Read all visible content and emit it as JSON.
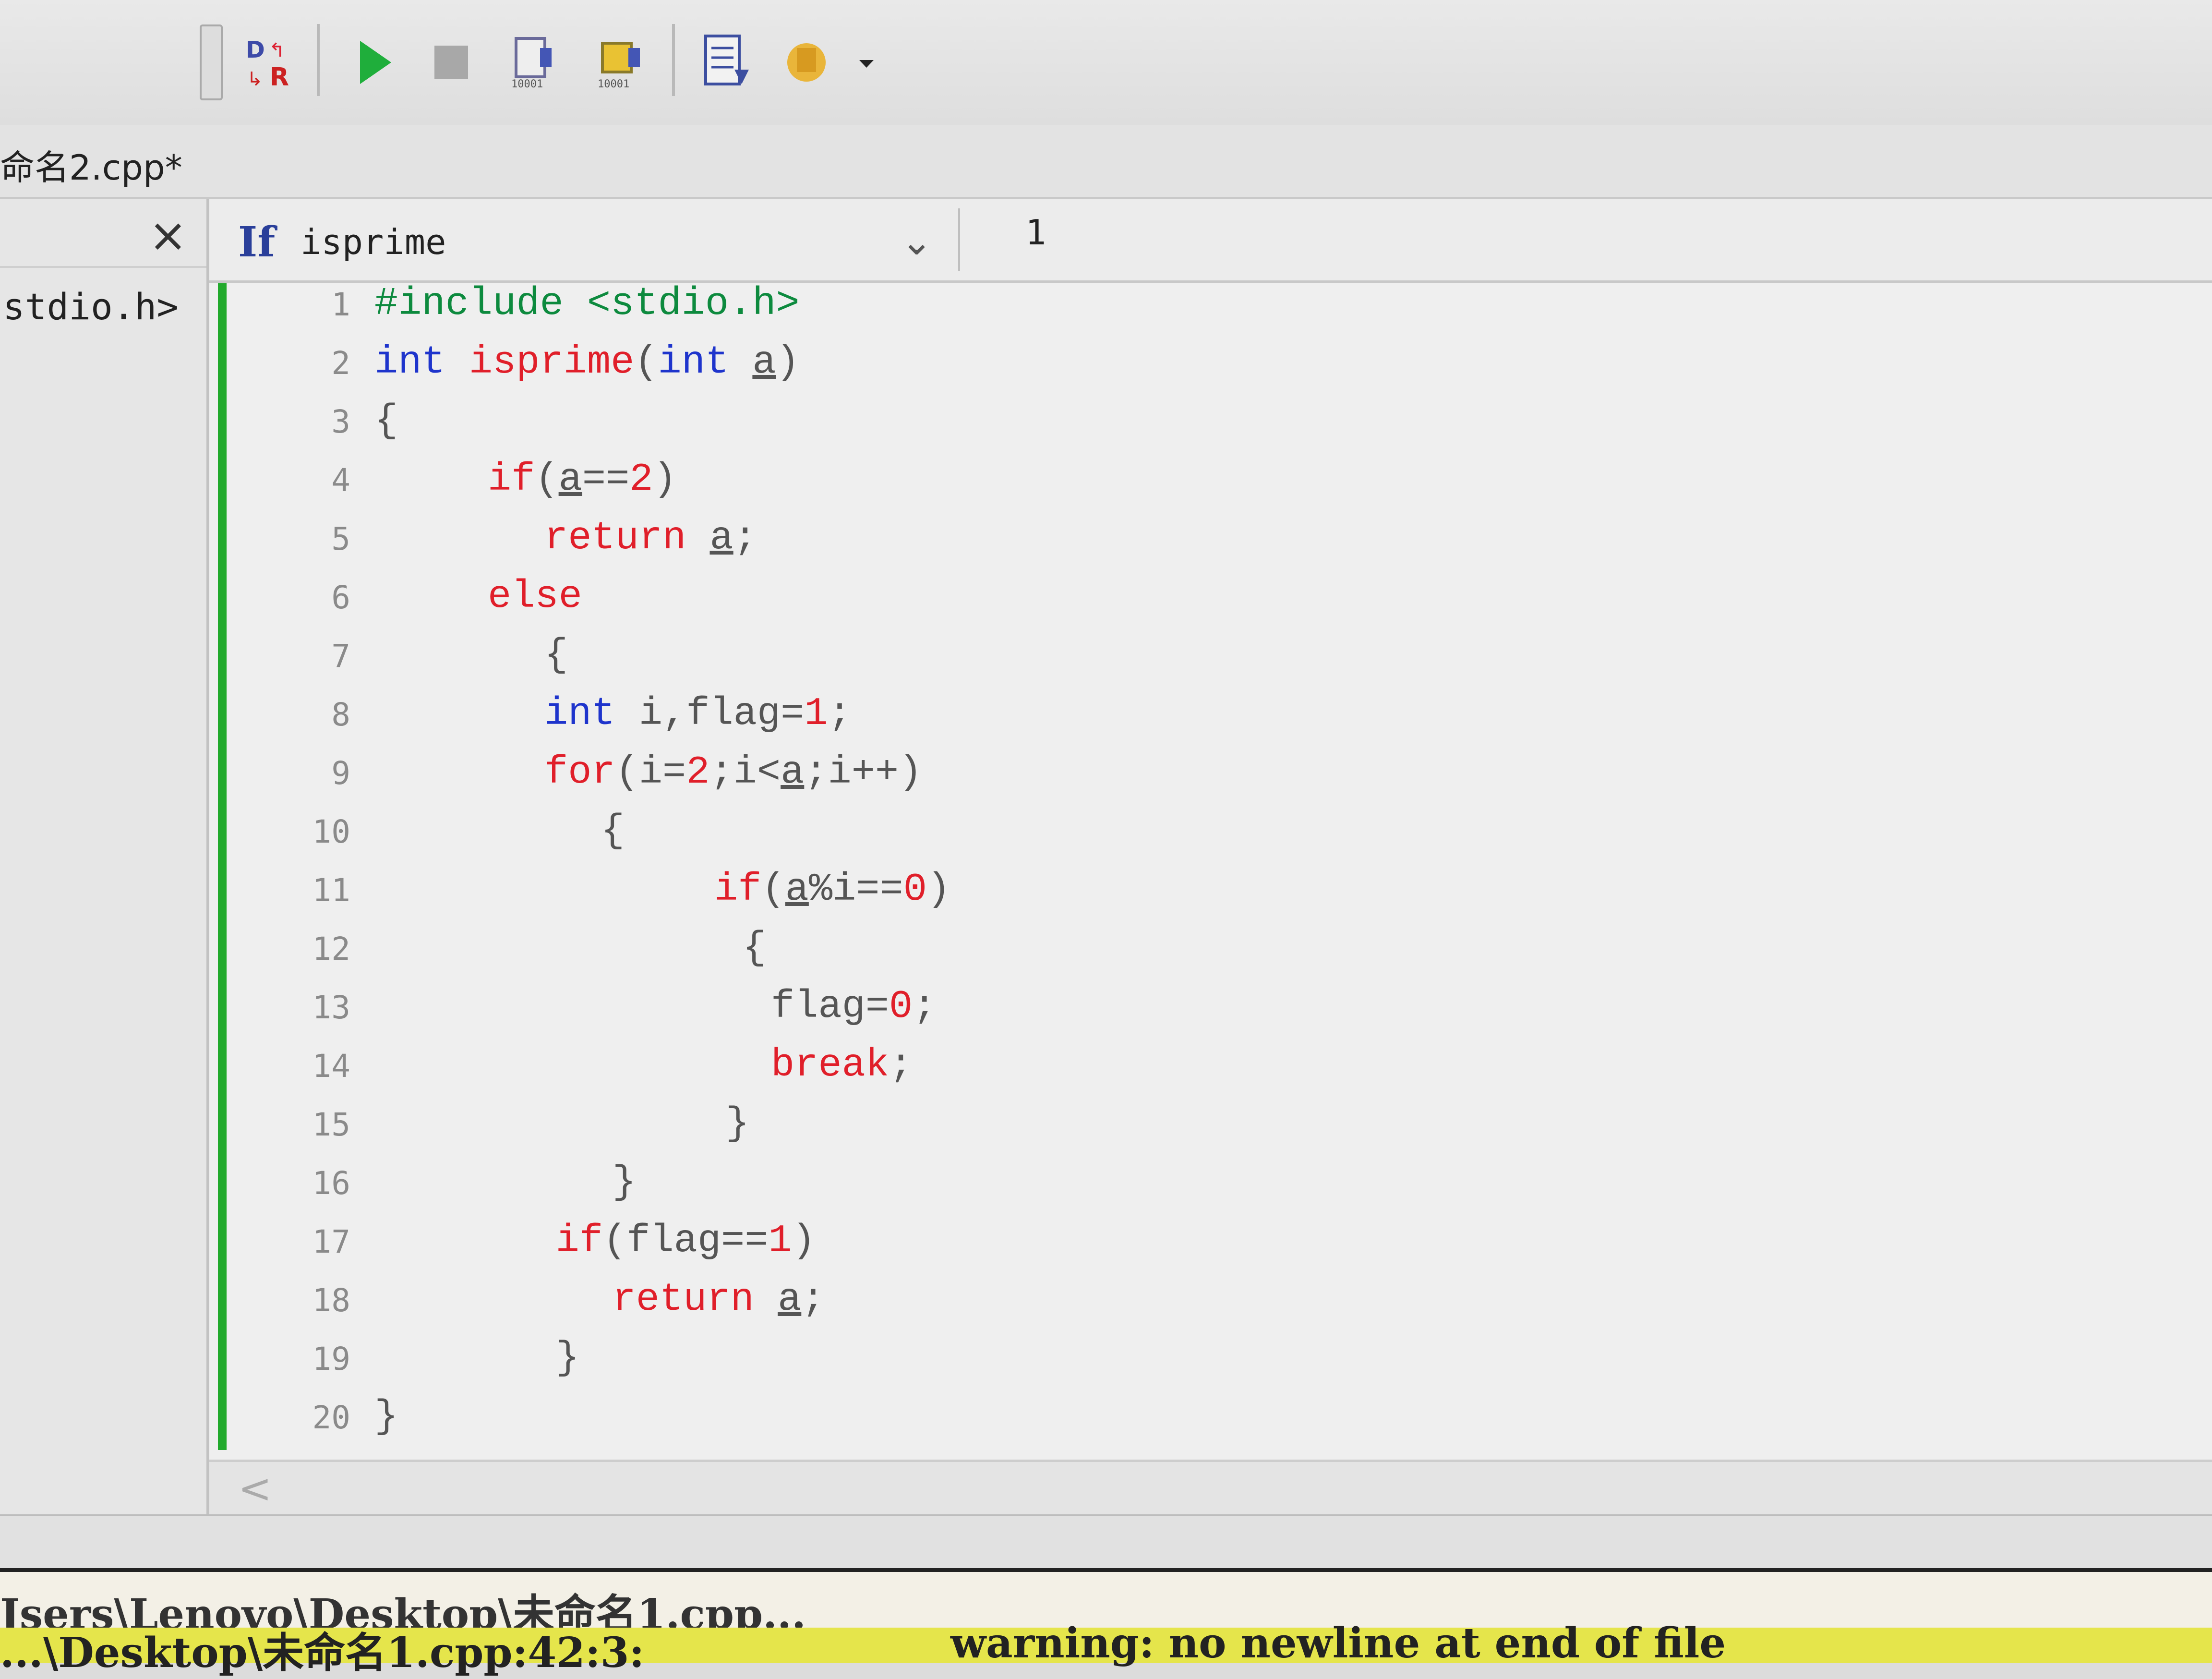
{
  "toolbar": {
    "icons": [
      "compile-run-icon",
      "run-icon",
      "stop-icon",
      "debug-icon",
      "debug-step-icon",
      "code-file-icon",
      "tool-icon"
    ]
  },
  "file_tab": {
    "label": "命名2.cpp*"
  },
  "left_panel": {
    "close_label": "×",
    "item_label": "stdio.h>"
  },
  "editor": {
    "function_combo": {
      "icon_text": "If",
      "value": "isprime"
    },
    "line_indicator": "1",
    "lines": [
      {
        "n": "1",
        "indent": 0,
        "parts": [
          {
            "t": "#include <stdio.h>",
            "c": "pp-green"
          }
        ]
      },
      {
        "n": "2",
        "indent": 0,
        "parts": [
          {
            "t": "int ",
            "c": "kw-blue"
          },
          {
            "t": "isprime",
            "c": "kw-red"
          },
          {
            "t": "(",
            "c": "ident-gray"
          },
          {
            "t": "int ",
            "c": "kw-blue"
          },
          {
            "t": "a",
            "c": "ident-gray u"
          },
          {
            "t": ")",
            "c": "ident-gray"
          }
        ]
      },
      {
        "n": "3",
        "indent": 0,
        "parts": [
          {
            "t": "{",
            "c": "ident-gray"
          }
        ]
      },
      {
        "n": "4",
        "indent": 2,
        "parts": [
          {
            "t": "if",
            "c": "kw-red"
          },
          {
            "t": "(",
            "c": "ident-gray"
          },
          {
            "t": "a",
            "c": "ident-gray u"
          },
          {
            "t": "==",
            "c": "ident-gray"
          },
          {
            "t": "2",
            "c": "num-red"
          },
          {
            "t": ")",
            "c": "ident-gray"
          }
        ]
      },
      {
        "n": "5",
        "indent": 3,
        "parts": [
          {
            "t": "return ",
            "c": "kw-red"
          },
          {
            "t": "a",
            "c": "ident-gray u"
          },
          {
            "t": ";",
            "c": "ident-gray"
          }
        ]
      },
      {
        "n": "6",
        "indent": 2,
        "parts": [
          {
            "t": "else",
            "c": "kw-red"
          }
        ]
      },
      {
        "n": "7",
        "indent": 3,
        "parts": [
          {
            "t": "{",
            "c": "ident-gray"
          }
        ]
      },
      {
        "n": "8",
        "indent": 3,
        "parts": [
          {
            "t": "int ",
            "c": "kw-blue"
          },
          {
            "t": "i,flag=",
            "c": "ident-gray"
          },
          {
            "t": "1",
            "c": "num-red"
          },
          {
            "t": ";",
            "c": "ident-gray"
          }
        ]
      },
      {
        "n": "9",
        "indent": 3,
        "parts": [
          {
            "t": "for",
            "c": "kw-red"
          },
          {
            "t": "(i=",
            "c": "ident-gray"
          },
          {
            "t": "2",
            "c": "num-red"
          },
          {
            "t": ";i<",
            "c": "ident-gray"
          },
          {
            "t": "a",
            "c": "ident-gray u"
          },
          {
            "t": ";i++)",
            "c": "ident-gray"
          }
        ]
      },
      {
        "n": "10",
        "indent": 4,
        "parts": [
          {
            "t": "{",
            "c": "ident-gray"
          }
        ]
      },
      {
        "n": "11",
        "indent": 6,
        "parts": [
          {
            "t": "if",
            "c": "kw-red"
          },
          {
            "t": "(",
            "c": "ident-gray"
          },
          {
            "t": "a",
            "c": "ident-gray u"
          },
          {
            "t": "%i==",
            "c": "ident-gray"
          },
          {
            "t": "0",
            "c": "num-red"
          },
          {
            "t": ")",
            "c": "ident-gray"
          }
        ]
      },
      {
        "n": "12",
        "indent": 6.5,
        "parts": [
          {
            "t": "{",
            "c": "ident-gray"
          }
        ]
      },
      {
        "n": "13",
        "indent": 7,
        "parts": [
          {
            "t": "flag=",
            "c": "ident-gray"
          },
          {
            "t": "0",
            "c": "num-red"
          },
          {
            "t": ";",
            "c": "ident-gray"
          }
        ]
      },
      {
        "n": "14",
        "indent": 7,
        "parts": [
          {
            "t": "break",
            "c": "kw-red"
          },
          {
            "t": ";",
            "c": "ident-gray"
          }
        ]
      },
      {
        "n": "15",
        "indent": 6.2,
        "parts": [
          {
            "t": "}",
            "c": "ident-gray"
          }
        ]
      },
      {
        "n": "16",
        "indent": 4.2,
        "parts": [
          {
            "t": "}",
            "c": "ident-gray"
          }
        ]
      },
      {
        "n": "17",
        "indent": 3.2,
        "parts": [
          {
            "t": "if",
            "c": "kw-red"
          },
          {
            "t": "(flag==",
            "c": "ident-gray"
          },
          {
            "t": "1",
            "c": "num-red"
          },
          {
            "t": ")",
            "c": "ident-gray"
          }
        ]
      },
      {
        "n": "18",
        "indent": 4.2,
        "parts": [
          {
            "t": "return ",
            "c": "kw-red"
          },
          {
            "t": "a",
            "c": "ident-gray u"
          },
          {
            "t": ";",
            "c": "ident-gray"
          }
        ]
      },
      {
        "n": "19",
        "indent": 3.2,
        "parts": [
          {
            "t": "}",
            "c": "ident-gray"
          }
        ]
      },
      {
        "n": "20",
        "indent": 0,
        "parts": [
          {
            "t": "}",
            "c": "ident-gray"
          }
        ]
      }
    ]
  },
  "hscroll": {
    "left_arrow": "<"
  },
  "status": {
    "path_text": "Jsers\\Lenovo\\Desktop\\未命名1.cpp...",
    "warning_left": "...\\Desktop\\未命名1.cpp:42:3:",
    "warning_text": "warning: no newline at end of file"
  },
  "colors": {
    "keyword_blue": "#1e34cc",
    "keyword_red": "#e01f2a",
    "preprocessor_green": "#0d8a3e",
    "gutter_green": "#22aa2c",
    "warning_yellow": "#e5e54b"
  }
}
